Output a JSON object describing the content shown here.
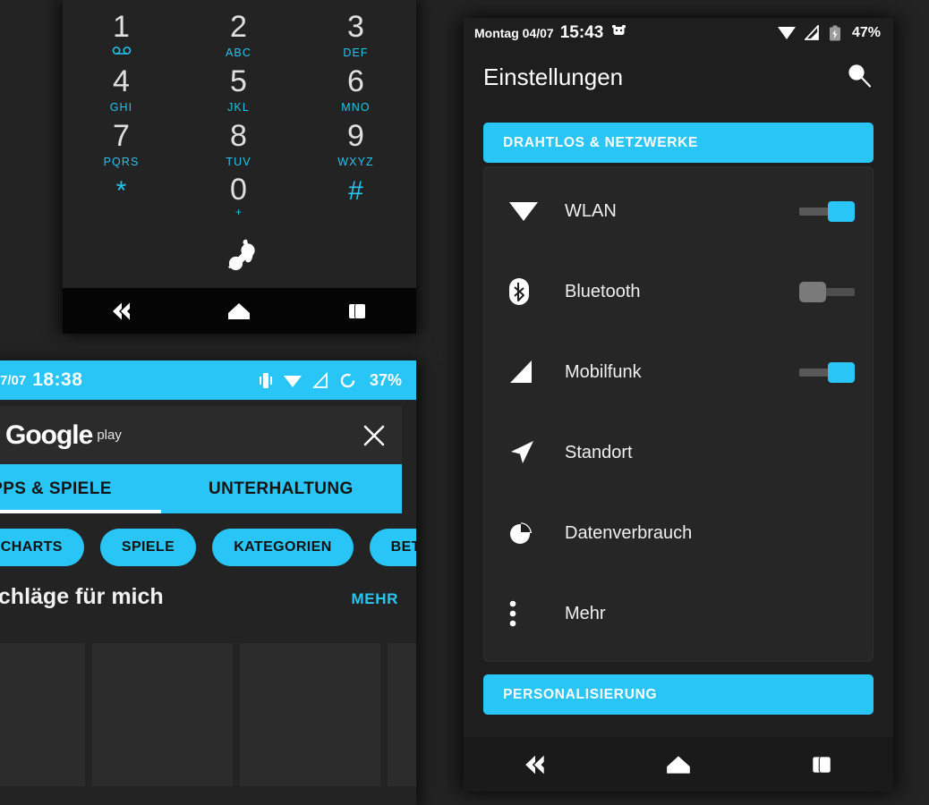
{
  "dialer": {
    "keys": [
      {
        "digit": "1",
        "letters": "",
        "icon": "voicemail-icon"
      },
      {
        "digit": "2",
        "letters": "ABC",
        "icon": ""
      },
      {
        "digit": "3",
        "letters": "DEF",
        "icon": ""
      },
      {
        "digit": "4",
        "letters": "GHI",
        "icon": ""
      },
      {
        "digit": "5",
        "letters": "JKL",
        "icon": ""
      },
      {
        "digit": "6",
        "letters": "MNO",
        "icon": ""
      },
      {
        "digit": "7",
        "letters": "PQRS",
        "icon": ""
      },
      {
        "digit": "8",
        "letters": "TUV",
        "icon": ""
      },
      {
        "digit": "9",
        "letters": "WXYZ",
        "icon": ""
      },
      {
        "digit": "*",
        "letters": "",
        "icon": ""
      },
      {
        "digit": "0",
        "letters": "+",
        "icon": ""
      },
      {
        "digit": "#",
        "letters": "",
        "icon": ""
      }
    ],
    "call_button": "call-icon",
    "nav": {
      "back": "back-icon",
      "home": "home-icon",
      "recents": "recents-icon"
    }
  },
  "play": {
    "status": {
      "date": "7/07",
      "time": "18:38",
      "battery": "37%",
      "icons": [
        "vibrate-icon",
        "wifi-icon",
        "signal-icon",
        "sync-icon"
      ]
    },
    "logo": "Google",
    "logo_sub": "play",
    "close": "close-icon",
    "tabs": [
      {
        "label": "APPS & SPIELE",
        "active": true
      },
      {
        "label": "UNTERHALTUNG",
        "active": false
      }
    ],
    "chips": [
      "P-CHARTS",
      "SPIELE",
      "KATEGORIEN",
      "BETA"
    ],
    "section_title": "schläge für mich",
    "more_label": "MEHR",
    "cards": [
      "",
      "",
      "",
      ""
    ]
  },
  "settings": {
    "status": {
      "date": "Montag 04/07",
      "time": "15:43",
      "battery": "47%",
      "icons": [
        "alarm-icon",
        "wifi-icon",
        "signal-icon",
        "battery-icon"
      ]
    },
    "title": "Einstellungen",
    "search": "search-icon",
    "sections": [
      {
        "header": "DRAHTLOS & NETZWERKE",
        "rows": [
          {
            "icon": "wifi-icon",
            "label": "WLAN",
            "toggle": "on"
          },
          {
            "icon": "bluetooth-icon",
            "label": "Bluetooth",
            "toggle": "off"
          },
          {
            "icon": "cellular-icon",
            "label": "Mobilfunk",
            "toggle": "on"
          },
          {
            "icon": "location-icon",
            "label": "Standort",
            "toggle": "none"
          },
          {
            "icon": "data-usage-icon",
            "label": "Datenverbrauch",
            "toggle": "none"
          },
          {
            "icon": "more-vert-icon",
            "label": "Mehr",
            "toggle": "none"
          }
        ]
      },
      {
        "header": "PERSONALISIERUNG",
        "rows": []
      }
    ],
    "nav": {
      "back": "back-icon",
      "home": "home-icon",
      "recents": "recents-icon"
    },
    "accent_color": "#29c5f6"
  }
}
